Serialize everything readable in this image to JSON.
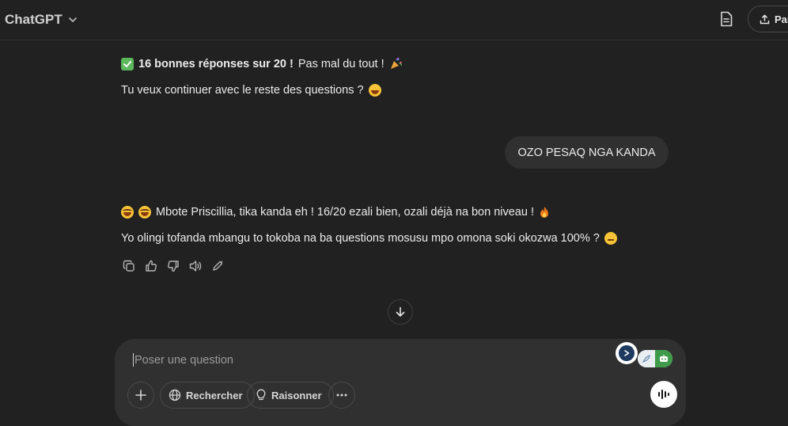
{
  "header": {
    "model_label": "ChatGPT",
    "share_label": "Par"
  },
  "conversation": {
    "assistant_1": {
      "score_bold": "16 bonnes réponses sur 20 !",
      "score_rest": "Pas mal du tout !",
      "question": "Tu veux continuer avec le reste des questions ?"
    },
    "user_message": "OZO PESAQ NGA KANDA",
    "assistant_2": {
      "line_1": "Mbote Priscillia, tika kanda eh ! 16/20 ezali bien, ozali déjà na bon niveau !",
      "line_2": "Yo olingi tofanda mbangu to tokoba na ba questions mosusu mpo omona soki okozwa 100% ?"
    }
  },
  "composer": {
    "placeholder": "Poser une question",
    "search_label": "Rechercher",
    "reason_label": "Raisonner"
  },
  "icons": {
    "model_chevron": "chevron-down-icon",
    "document": "document-icon",
    "share": "share-icon",
    "copy": "copy-icon",
    "thumbs_up": "thumbs-up-icon",
    "thumbs_down": "thumbs-down-icon",
    "read_aloud": "speaker-icon",
    "edit": "edit-icon",
    "scroll_down": "arrow-down-icon",
    "plus": "plus-icon",
    "globe": "globe-icon",
    "bulb": "lightbulb-icon",
    "more": "more-icon",
    "voice": "voice-waveform-icon"
  }
}
